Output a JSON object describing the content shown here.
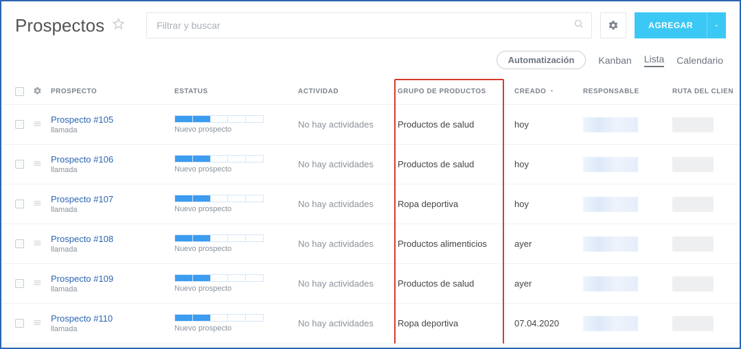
{
  "header": {
    "title": "Prospectos",
    "search_placeholder": "Filtrar y buscar",
    "add_label": "AGREGAR"
  },
  "subheader": {
    "automation": "Automatización",
    "kanban": "Kanban",
    "list": "Lista",
    "calendar": "Calendario"
  },
  "columns": {
    "prospect": "PROSPECTO",
    "status": "ESTATUS",
    "activity": "ACTIVIDAD",
    "product_group": "GRUPO DE PRODUCTOS",
    "created": "CREADO",
    "responsible": "RESPONSABLE",
    "client_route": "RUTA DEL CLIEN"
  },
  "rows": [
    {
      "name": "Prospecto #105",
      "sub": "llamada",
      "status": "Nuevo prospecto",
      "activity": "No hay actividades",
      "group": "Productos de salud",
      "created": "hoy"
    },
    {
      "name": "Prospecto #106",
      "sub": "llamada",
      "status": "Nuevo prospecto",
      "activity": "No hay actividades",
      "group": "Productos de salud",
      "created": "hoy"
    },
    {
      "name": "Prospecto #107",
      "sub": "llamada",
      "status": "Nuevo prospecto",
      "activity": "No hay actividades",
      "group": "Ropa deportiva",
      "created": "hoy"
    },
    {
      "name": "Prospecto #108",
      "sub": "llamada",
      "status": "Nuevo prospecto",
      "activity": "No hay actividades",
      "group": "Productos alimenticios",
      "created": "ayer"
    },
    {
      "name": "Prospecto #109",
      "sub": "llamada",
      "status": "Nuevo prospecto",
      "activity": "No hay actividades",
      "group": "Productos de salud",
      "created": "ayer"
    },
    {
      "name": "Prospecto #110",
      "sub": "llamada",
      "status": "Nuevo prospecto",
      "activity": "No hay actividades",
      "group": "Ropa deportiva",
      "created": "07.04.2020"
    }
  ]
}
